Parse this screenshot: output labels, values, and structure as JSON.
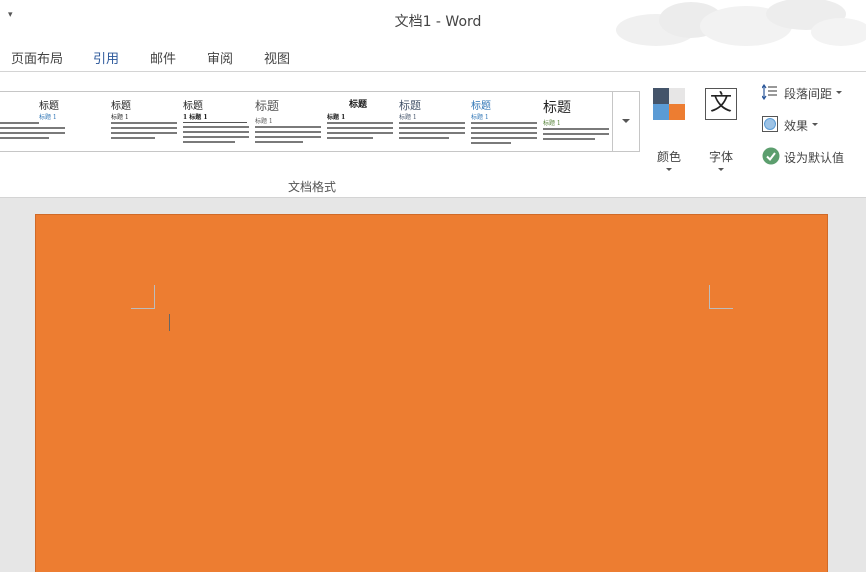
{
  "window": {
    "title": "文档1 - Word",
    "qat_customize_glyph": "▾"
  },
  "tabs": [
    {
      "label": "页面布局",
      "active": false
    },
    {
      "label": "引用",
      "active": true
    },
    {
      "label": "邮件",
      "active": false
    },
    {
      "label": "审阅",
      "active": false
    },
    {
      "label": "视图",
      "active": false
    }
  ],
  "ribbon": {
    "style_gallery": {
      "group_label": "文档格式",
      "thumbnails": [
        {
          "title": "标题",
          "subtitle": "标题 1"
        },
        {
          "title": "标题",
          "subtitle": "标题 1"
        },
        {
          "title": "标题",
          "subtitle": "1 标题 1"
        },
        {
          "title": "标题",
          "subtitle": "标题 1"
        },
        {
          "title": "标题",
          "subtitle": "标题 1"
        },
        {
          "title": "标题",
          "subtitle": "标题 1"
        },
        {
          "title": "标题",
          "subtitle": "标题 1"
        },
        {
          "title": "标题",
          "subtitle": "标题 1"
        }
      ]
    },
    "colors_button": {
      "label": "颜色",
      "icon": "color-palette-icon"
    },
    "fonts_button": {
      "label": "字体",
      "icon_glyph": "文"
    },
    "paragraph_spacing": {
      "label": "段落间距",
      "icon": "paragraph-spacing-icon"
    },
    "effects": {
      "label": "效果",
      "icon": "effects-icon"
    },
    "set_default": {
      "label": "设为默认值",
      "icon": "checkmark-icon"
    }
  },
  "theme_colors": {
    "accent": "#2b579a",
    "page_color": "#ed7d31",
    "palette": [
      "#44546a",
      "#e7e6e6",
      "#5b9bd5",
      "#ed7d31"
    ],
    "default_check": "#5c9e6e"
  }
}
